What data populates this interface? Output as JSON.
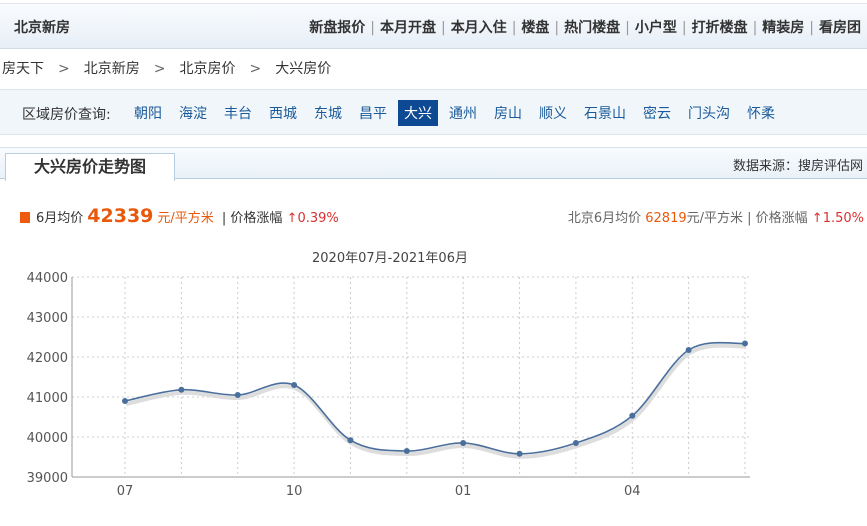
{
  "topnav": {
    "brand": "北京新房",
    "links": [
      "新盘报价",
      "本月开盘",
      "本月入住",
      "楼盘",
      "热门楼盘",
      "小户型",
      "打折楼盘",
      "精装房",
      "看房团"
    ]
  },
  "breadcrumb": [
    "房天下",
    "北京新房",
    "北京房价",
    "大兴房价"
  ],
  "areas": {
    "label": "区域房价查询:",
    "items": [
      "朝阳",
      "海淀",
      "丰台",
      "西城",
      "东城",
      "昌平",
      "大兴",
      "通州",
      "房山",
      "顺义",
      "石景山",
      "密云",
      "门头沟",
      "怀柔"
    ],
    "active": "大兴"
  },
  "panel": {
    "tab": "大兴房价走势图",
    "source": "数据来源：搜房评估网"
  },
  "stats": {
    "month_label": "6月均价",
    "price": "42339",
    "unit": "元/平方米",
    "change_label": "| 价格涨幅",
    "change": "↑0.39%",
    "bj_label": "北京6月均价",
    "bj_price": "62819",
    "bj_unit": "元/平方米 | 价格涨幅",
    "bj_change": "↑1.50%"
  },
  "colors": {
    "accent": "#e8590c",
    "line": "#4a6f9c",
    "nav_active": "#0e4a94"
  },
  "chart_data": {
    "type": "line",
    "title": "2020年07月-2021年06月",
    "x": [
      "2020-07",
      "2020-08",
      "2020-09",
      "2020-10",
      "2020-11",
      "2020-12",
      "2021-01",
      "2021-02",
      "2021-03",
      "2021-04",
      "2021-05",
      "2021-06"
    ],
    "xticks": [
      {
        "i": 0,
        "label": "07"
      },
      {
        "i": 3,
        "label": "10"
      },
      {
        "i": 6,
        "label": "01"
      },
      {
        "i": 9,
        "label": "04"
      }
    ],
    "values": [
      40900,
      41180,
      41050,
      41300,
      39920,
      39650,
      39850,
      39580,
      39850,
      40530,
      42175,
      42339
    ],
    "ylim": [
      39000,
      44000
    ],
    "yticks": [
      39000,
      40000,
      41000,
      42000,
      43000,
      44000
    ],
    "grid": true
  }
}
